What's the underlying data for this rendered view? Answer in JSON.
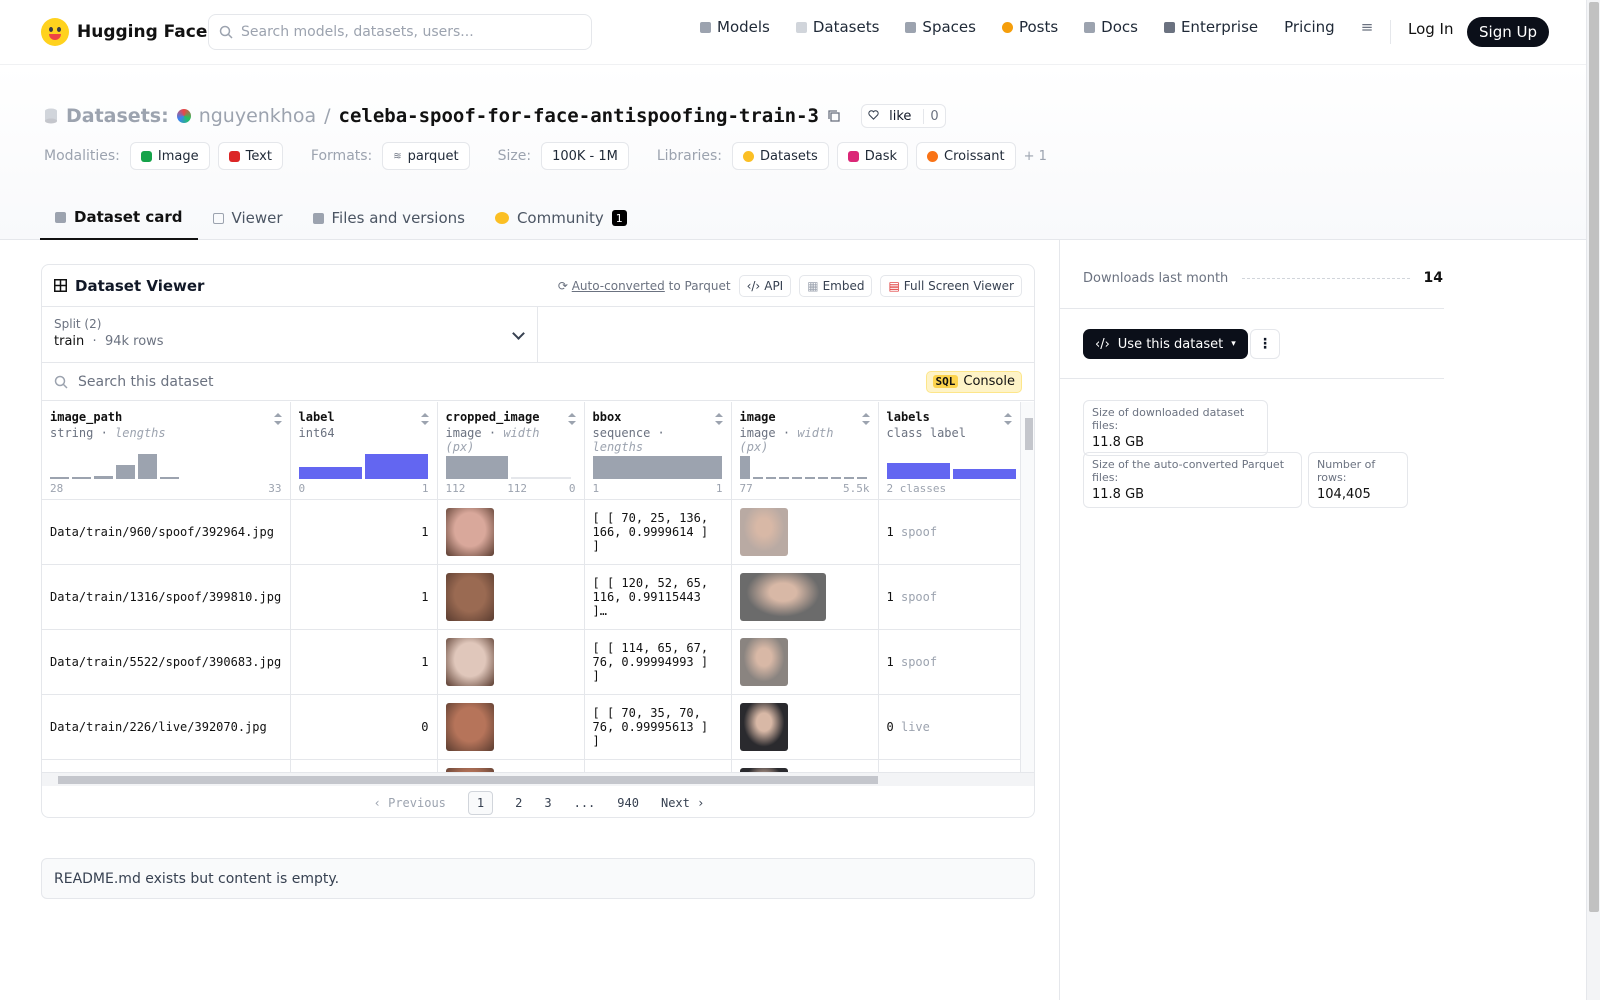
{
  "brand": {
    "name": "Hugging Face"
  },
  "search": {
    "placeholder": "Search models, datasets, users..."
  },
  "nav": {
    "items": [
      {
        "label": "Models",
        "color": "#9ca3af"
      },
      {
        "label": "Datasets",
        "color": "#d1d5db"
      },
      {
        "label": "Spaces",
        "color": "#9ca3af"
      },
      {
        "label": "Posts",
        "color": "#f59e0b"
      },
      {
        "label": "Docs",
        "color": "#9ca3af"
      },
      {
        "label": "Enterprise",
        "color": "#6b7280"
      },
      {
        "label": "Pricing",
        "color": ""
      }
    ],
    "login": "Log In",
    "signup": "Sign Up"
  },
  "repo": {
    "section": "Datasets:",
    "owner": "nguyenkhoa",
    "separator": "/",
    "name": "celeba-spoof-for-face-antispoofing-train-3",
    "like_label": "like",
    "like_count": "0"
  },
  "meta": {
    "modalities_label": "Modalities:",
    "modalities": [
      {
        "label": "Image",
        "color": "#16a34a"
      },
      {
        "label": "Text",
        "color": "#dc2626"
      }
    ],
    "formats_label": "Formats:",
    "format": "parquet",
    "size_label": "Size:",
    "size": "100K - 1M",
    "libraries_label": "Libraries:",
    "libraries": [
      {
        "label": "Datasets",
        "color": "#fbbf24"
      },
      {
        "label": "Dask",
        "color": "#db2777"
      },
      {
        "label": "Croissant",
        "color": "#f97316"
      }
    ],
    "more": "+ 1"
  },
  "tabs": [
    {
      "label": "Dataset card",
      "active": true
    },
    {
      "label": "Viewer"
    },
    {
      "label": "Files and versions"
    },
    {
      "label": "Community",
      "badge": "1"
    }
  ],
  "viewer": {
    "title": "Dataset Viewer",
    "auto_converted": "Auto-converted",
    "to_parquet": "to Parquet",
    "api": "API",
    "embed": "Embed",
    "fullscreen": "Full Screen Viewer",
    "split_label": "Split (2)",
    "split_value": "train",
    "split_rows": "94k rows",
    "search_placeholder": "Search this dataset",
    "sql_tag": "SQL",
    "sql_console": "Console",
    "columns": [
      {
        "name": "image_path",
        "type": "string",
        "sub": "lengths",
        "min": "28",
        "max": "33",
        "hist": [
          0.05,
          0.05,
          0.1,
          0.55,
          0.95,
          0.05
        ],
        "hist_color": "gray"
      },
      {
        "name": "label",
        "type": "int64",
        "sub": "",
        "min": "0",
        "max": "1",
        "hist": [
          0.45,
          0.95
        ],
        "hist_color": "blue"
      },
      {
        "name": "cropped_image",
        "type": "image",
        "sub": "width (px)",
        "min": "112",
        "mid": "112",
        "max": "0",
        "hist": [
          0.9
        ],
        "hist_color": "gray"
      },
      {
        "name": "bbox",
        "type": "sequence",
        "sub": "lengths",
        "min": "1",
        "max": "1",
        "hist": [
          0.9
        ],
        "hist_color": "gray"
      },
      {
        "name": "image",
        "type": "image",
        "sub": "width (px)",
        "min": "77",
        "max": "5.5k",
        "hist": [
          0.9,
          0.05,
          0.05,
          0.05,
          0.05,
          0.05,
          0.05,
          0.05,
          0.05,
          0.05
        ],
        "hist_color": "gray"
      },
      {
        "name": "labels",
        "type": "class label",
        "sub": "",
        "min": "2 classes",
        "max": "",
        "hist": [
          0.6,
          0.4
        ],
        "hist_color": "blue"
      }
    ],
    "rows": [
      {
        "image_path": "Data/train/960/spoof/392964.jpg",
        "label": "1",
        "bbox": "[ [ 70, 25, 136, 166, 0.9999614 ] ]",
        "labels_id": "1",
        "labels_name": "spoof",
        "crop_color": "#d9a89b",
        "img_color": "#b9aaa3",
        "img_wide": false
      },
      {
        "image_path": "Data/train/1316/spoof/399810.jpg",
        "label": "1",
        "bbox": "[ [ 120, 52, 65, 116, 0.99115443 ]…",
        "labels_id": "1",
        "labels_name": "spoof",
        "crop_color": "#9a6a52",
        "img_color": "#6b6b6b",
        "img_wide": true
      },
      {
        "image_path": "Data/train/5522/spoof/390683.jpg",
        "label": "1",
        "bbox": "[ [ 114, 65, 67, 76, 0.99994993 ] ]",
        "labels_id": "1",
        "labels_name": "spoof",
        "crop_color": "#e0c7bb",
        "img_color": "#8a8480",
        "img_wide": false
      },
      {
        "image_path": "Data/train/226/live/392070.jpg",
        "label": "0",
        "bbox": "[ [ 70, 35, 70, 76, 0.99995613 ] ]",
        "labels_id": "0",
        "labels_name": "live",
        "crop_color": "#b6745a",
        "img_color": "#2a2a2e",
        "img_wide": false
      },
      {
        "image_path": "",
        "label": "",
        "bbox": "",
        "labels_id": "",
        "labels_name": "",
        "crop_color": "#b6745a",
        "img_color": "#2a2a2e",
        "img_wide": false
      }
    ],
    "pager": {
      "prev": "Previous",
      "pages": [
        "1",
        "2",
        "3",
        "...",
        "940"
      ],
      "next": "Next"
    }
  },
  "readme": "README.md exists but content is empty.",
  "sidebar": {
    "downloads_label": "Downloads last month",
    "downloads_value": "14",
    "use_button": "Use this dataset",
    "stats": [
      {
        "k": "Size of downloaded dataset files:",
        "v": "11.8 GB"
      },
      {
        "k": "Size of the auto-converted Parquet files:",
        "v": "11.8 GB"
      },
      {
        "k": "Number of rows:",
        "v": "104,405"
      }
    ]
  }
}
